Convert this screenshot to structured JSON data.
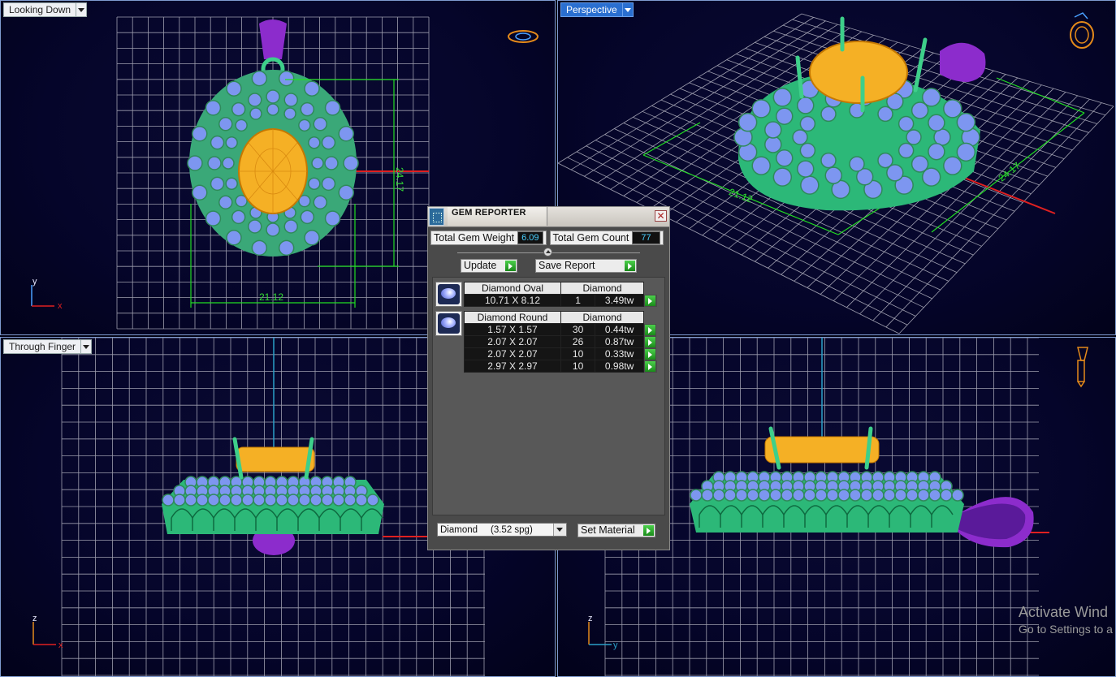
{
  "viewports": {
    "top_left": {
      "label": "Looking Down",
      "dims": {
        "h": "24.17",
        "w": "21.12"
      },
      "axes": [
        "y",
        "x"
      ]
    },
    "top_right": {
      "label": "Perspective",
      "dims": {
        "w": "21.12",
        "h": "24.17"
      }
    },
    "bottom_left": {
      "label": "Through Finger",
      "axes": [
        "z",
        "x"
      ]
    },
    "bottom_right": {
      "axes": [
        "z",
        "y"
      ]
    }
  },
  "gem_reporter": {
    "title": "GEM REPORTER",
    "close": "✕",
    "total_weight_label": "Total Gem Weight",
    "total_weight": "6.09",
    "total_count_label": "Total Gem Count",
    "total_count": "77",
    "update_label": "Update",
    "save_label": "Save Report",
    "groups": [
      {
        "shape": "Diamond Oval",
        "material": "Diamond",
        "rows": [
          {
            "size": "10.71 X 8.12",
            "count": "1",
            "weight": "3.49tw"
          }
        ]
      },
      {
        "shape": "Diamond Round",
        "material": "Diamond",
        "rows": [
          {
            "size": "1.57 X 1.57",
            "count": "30",
            "weight": "0.44tw"
          },
          {
            "size": "2.07 X 2.07",
            "count": "26",
            "weight": "0.87tw"
          },
          {
            "size": "2.07 X 2.07",
            "count": "10",
            "weight": "0.33tw"
          },
          {
            "size": "2.97 X 2.97",
            "count": "10",
            "weight": "0.98tw"
          }
        ]
      }
    ],
    "material_select": "Diamond     (3.52 spg)",
    "set_material_label": "Set Material"
  },
  "watermark": {
    "line1": "Activate Wind",
    "line2": "Go to Settings to a"
  },
  "colors": {
    "grid": "#c8c8d0",
    "metal": "#3ecf8a",
    "gem_blue": "#7d96f0",
    "center_stone": "#f5b025",
    "bail": "#8c2ccc",
    "dim": "#22dd22",
    "red_axis": "#e02020"
  }
}
